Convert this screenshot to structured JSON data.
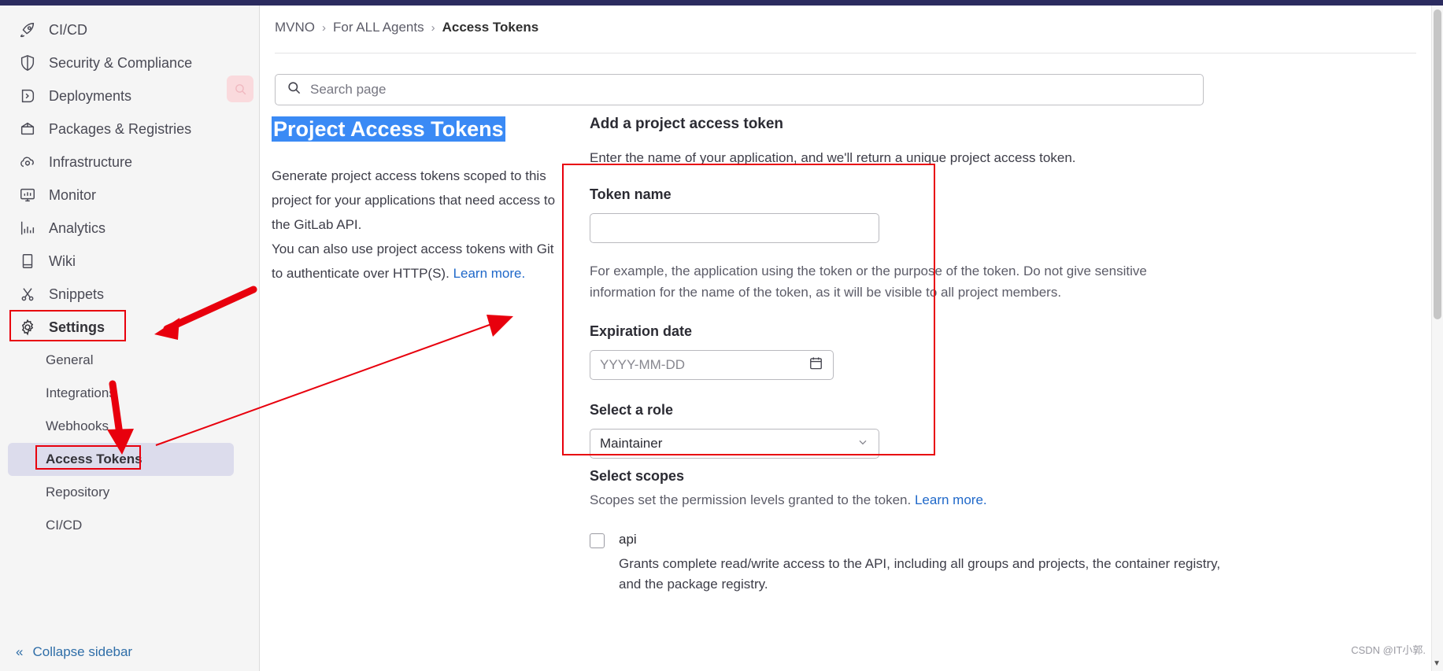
{
  "sidebar": {
    "nav_items": [
      {
        "label": "CI/CD",
        "icon": "rocket-icon"
      },
      {
        "label": "Security & Compliance",
        "icon": "shield-icon"
      },
      {
        "label": "Deployments",
        "icon": "deployments-icon"
      },
      {
        "label": "Packages & Registries",
        "icon": "package-icon"
      },
      {
        "label": "Infrastructure",
        "icon": "cloud-gear-icon"
      },
      {
        "label": "Monitor",
        "icon": "monitor-icon"
      },
      {
        "label": "Analytics",
        "icon": "chart-icon"
      },
      {
        "label": "Wiki",
        "icon": "book-icon"
      },
      {
        "label": "Snippets",
        "icon": "scissors-icon"
      },
      {
        "label": "Settings",
        "icon": "gear-icon"
      }
    ],
    "sub_items": [
      {
        "label": "General",
        "active": false
      },
      {
        "label": "Integrations",
        "active": false
      },
      {
        "label": "Webhooks",
        "active": false
      },
      {
        "label": "Access Tokens",
        "active": true
      },
      {
        "label": "Repository",
        "active": false
      },
      {
        "label": "CI/CD",
        "active": false
      }
    ],
    "collapse_label": "Collapse sidebar"
  },
  "breadcrumb": {
    "items": [
      "MVNO",
      "For ALL Agents",
      "Access Tokens"
    ],
    "separator": "›"
  },
  "search": {
    "placeholder": "Search page"
  },
  "left": {
    "title": "Project Access Tokens",
    "paragraph_1": "Generate project access tokens scoped to this project for your applications that need access to the GitLab API.",
    "paragraph_2": "You can also use project access tokens with Git to authenticate over HTTP(S).",
    "learn_more": "Learn more."
  },
  "form": {
    "heading": "Add a project access token",
    "subheading": "Enter the name of your application, and we'll return a unique project access token.",
    "token_name_label": "Token name",
    "token_name_value": "",
    "token_name_helper": "For example, the application using the token or the purpose of the token. Do not give sensitive information for the name of the token, as it will be visible to all project members.",
    "expiration_label": "Expiration date",
    "expiration_placeholder": "YYYY-MM-DD",
    "role_label": "Select a role",
    "role_value": "Maintainer"
  },
  "scopes": {
    "heading": "Select scopes",
    "description": "Scopes set the permission levels granted to the token.",
    "learn_more": "Learn more.",
    "items": [
      {
        "name": "api",
        "checked": false,
        "description": "Grants complete read/write access to the API, including all groups and projects, the container registry, and the package registry."
      }
    ]
  },
  "watermark": "CSDN @IT小郭."
}
